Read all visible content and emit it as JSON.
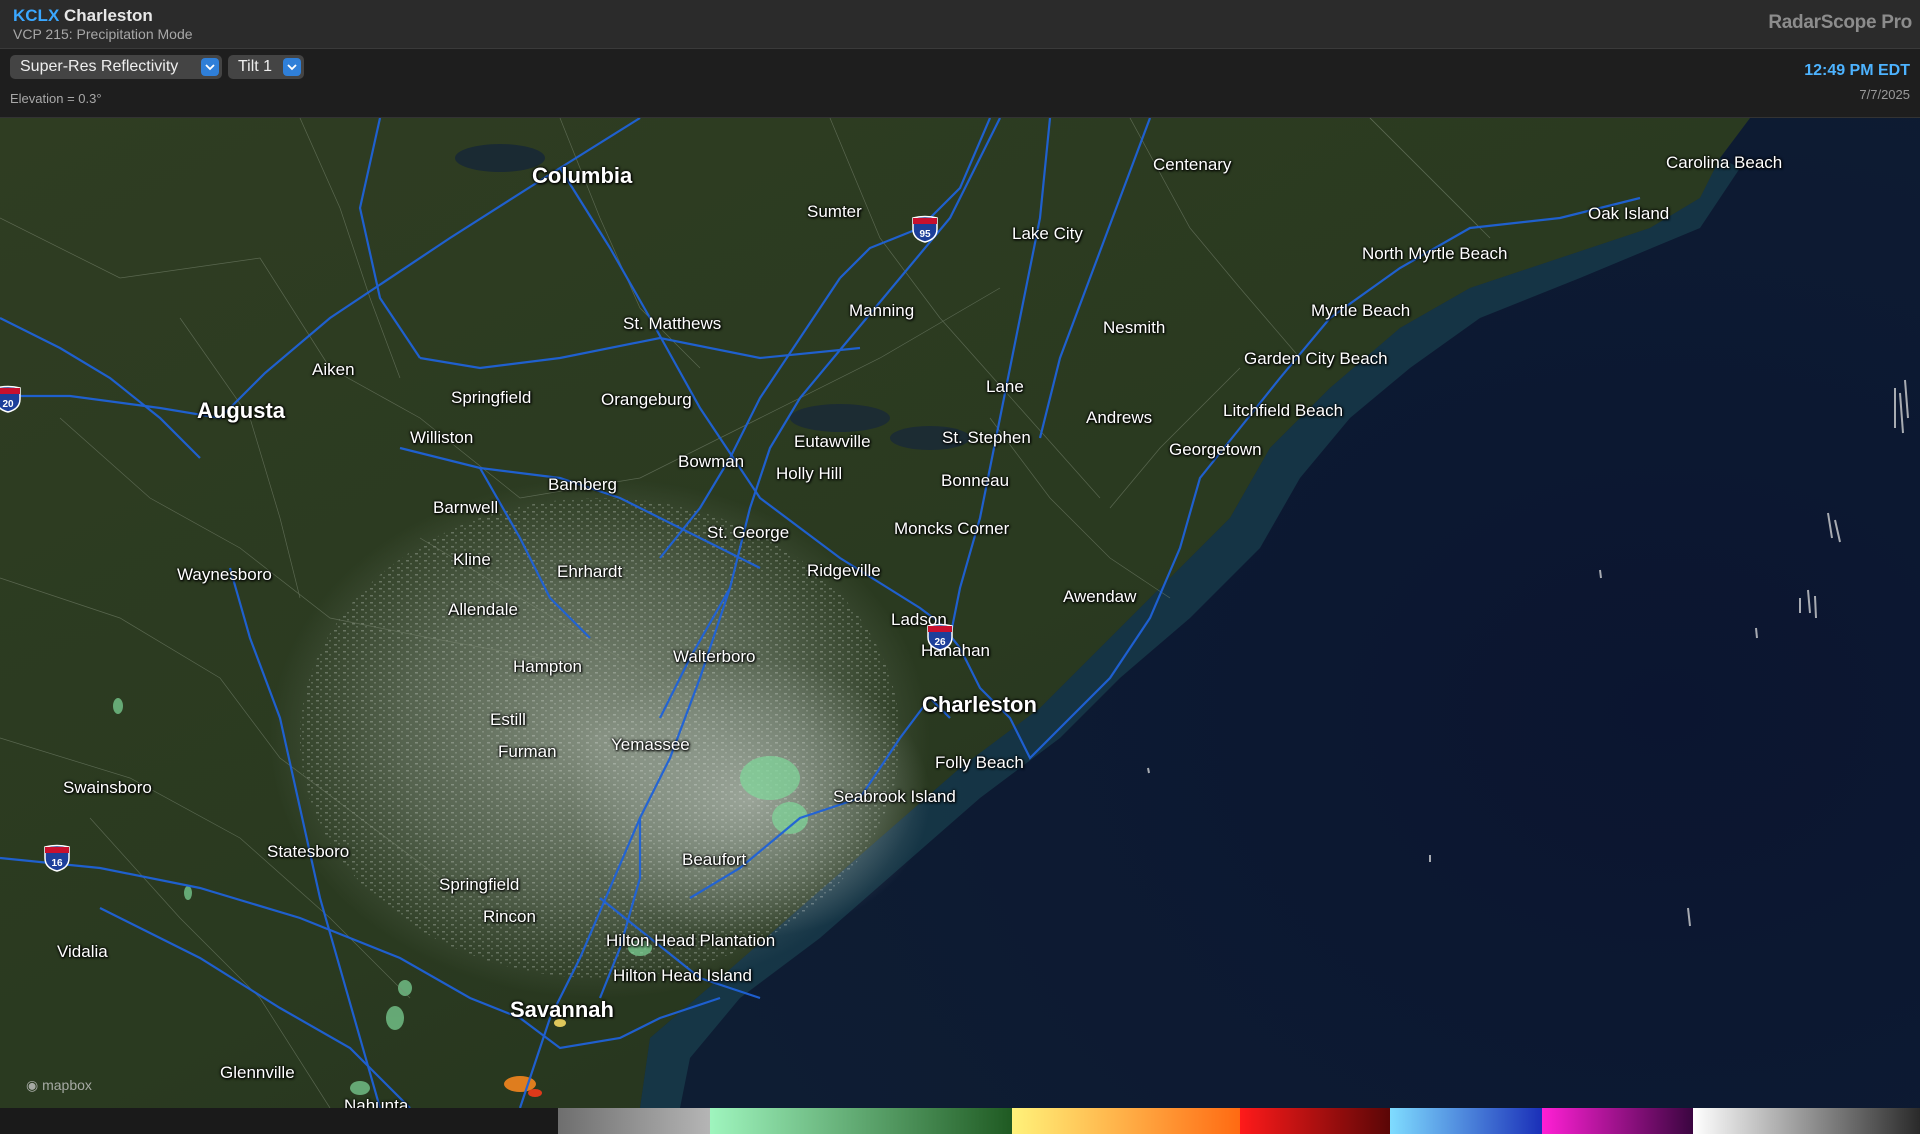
{
  "header": {
    "station_code": "KCLX",
    "station_name": "Charleston",
    "vcp": "VCP 215: Precipitation Mode",
    "brand": "RadarScope Pro"
  },
  "toolbar": {
    "product_label": "Super-Res Reflectivity",
    "tilt_label": "Tilt 1",
    "elevation": "Elevation = 0.3°",
    "time": "12:49 PM EDT",
    "date": "7/7/2025"
  },
  "map": {
    "attribution": "mapbox",
    "cities": [
      {
        "name": "Columbia",
        "major": true
      },
      {
        "name": "Sumter"
      },
      {
        "name": "Centenary"
      },
      {
        "name": "Carolina Beach"
      },
      {
        "name": "Oak Island"
      },
      {
        "name": "Lake City"
      },
      {
        "name": "North Myrtle Beach"
      },
      {
        "name": "Myrtle Beach"
      },
      {
        "name": "Garden City Beach"
      },
      {
        "name": "St. Matthews"
      },
      {
        "name": "Manning"
      },
      {
        "name": "Nesmith"
      },
      {
        "name": "Aiken"
      },
      {
        "name": "Augusta",
        "major": true
      },
      {
        "name": "Springfield"
      },
      {
        "name": "Orangeburg"
      },
      {
        "name": "Lane"
      },
      {
        "name": "Andrews"
      },
      {
        "name": "Litchfield Beach"
      },
      {
        "name": "Williston"
      },
      {
        "name": "Eutawville"
      },
      {
        "name": "St. Stephen"
      },
      {
        "name": "Georgetown"
      },
      {
        "name": "Bowman"
      },
      {
        "name": "Holly Hill"
      },
      {
        "name": "Bamberg"
      },
      {
        "name": "Bonneau"
      },
      {
        "name": "Barnwell"
      },
      {
        "name": "St. George"
      },
      {
        "name": "Moncks Corner"
      },
      {
        "name": "Kline"
      },
      {
        "name": "Ehrhardt"
      },
      {
        "name": "Ridgeville"
      },
      {
        "name": "Waynesboro"
      },
      {
        "name": "Awendaw"
      },
      {
        "name": "Allendale"
      },
      {
        "name": "Ladson"
      },
      {
        "name": "Hanahan"
      },
      {
        "name": "Walterboro"
      },
      {
        "name": "Hampton"
      },
      {
        "name": "Charleston",
        "major": true
      },
      {
        "name": "Estill"
      },
      {
        "name": "Yemassee"
      },
      {
        "name": "Furman"
      },
      {
        "name": "Folly Beach"
      },
      {
        "name": "Swainsboro"
      },
      {
        "name": "Seabrook Island"
      },
      {
        "name": "Statesboro"
      },
      {
        "name": "Beaufort"
      },
      {
        "name": "Springfield"
      },
      {
        "name": "Rincon"
      },
      {
        "name": "Vidalia"
      },
      {
        "name": "Hilton Head Plantation"
      },
      {
        "name": "Hilton Head Island"
      },
      {
        "name": "Savannah",
        "major": true
      },
      {
        "name": "Glennville"
      },
      {
        "name": "Nahunta"
      }
    ],
    "shields": [
      {
        "number": "95"
      },
      {
        "number": "20"
      },
      {
        "number": "26"
      },
      {
        "number": "16"
      }
    ]
  },
  "legend": {
    "segments": [
      {
        "colors": [
          "#6e6e6e",
          "#b5b5b5"
        ]
      },
      {
        "colors": [
          "#9ff5be",
          "#1f5a22"
        ]
      },
      {
        "colors": [
          "#fff27a",
          "#ff6a12"
        ]
      },
      {
        "colors": [
          "#ff1a1a",
          "#5a0606"
        ]
      },
      {
        "colors": [
          "#7fdcff",
          "#1a2fb8"
        ]
      },
      {
        "colors": [
          "#ff1fd5",
          "#3a0540"
        ]
      },
      {
        "colors": [
          "#ffffff",
          "#2a2a2a"
        ]
      }
    ]
  }
}
